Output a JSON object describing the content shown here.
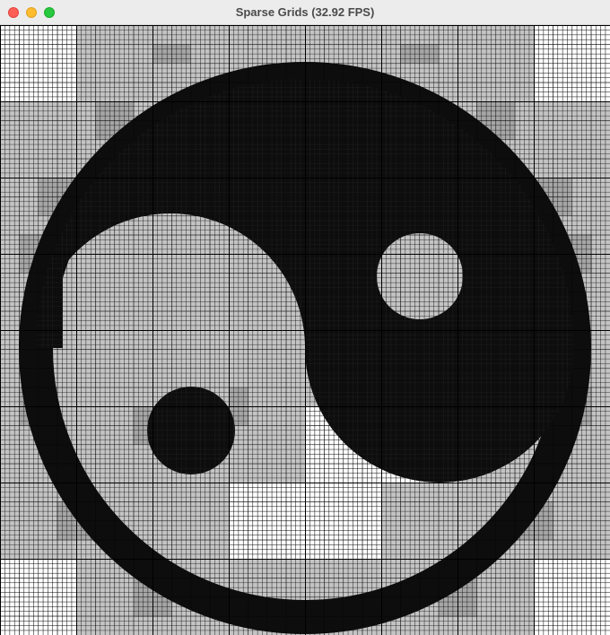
{
  "window": {
    "title": "Sparse Grids (32.92 FPS)",
    "controls": [
      "close",
      "minimize",
      "zoom"
    ]
  },
  "canvas": {
    "content": "yin-yang",
    "colors": {
      "coarse_cell": "#c4c4c4",
      "fine_cell": "#ffffff",
      "medium_cell": "#a6a6a6",
      "grid_line": "#000000",
      "shape_fill": "#0d0d0d"
    }
  }
}
